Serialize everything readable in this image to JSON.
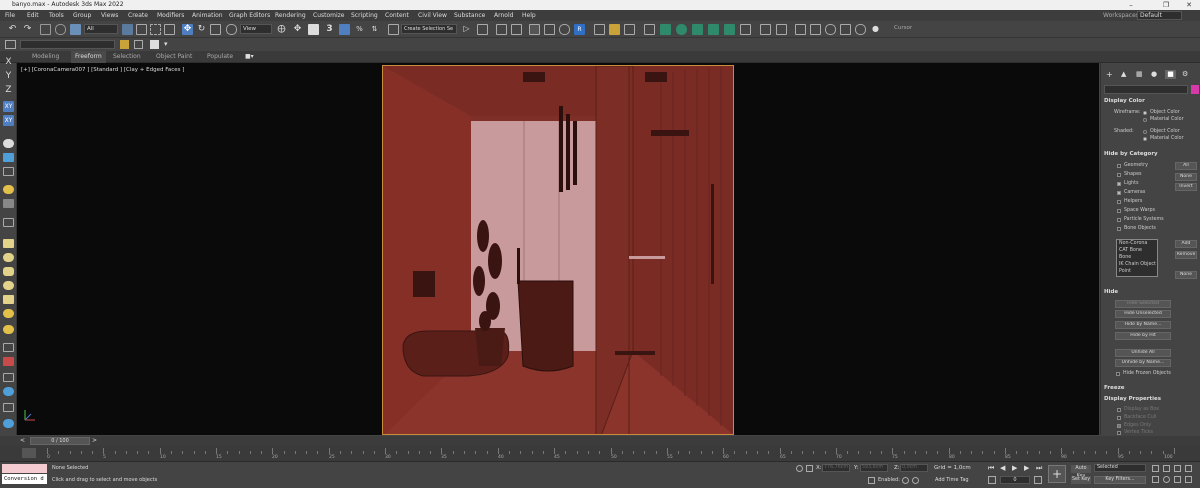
{
  "title": "banyo.max - Autodesk 3ds Max 2022",
  "menus": [
    "File",
    "Edit",
    "Tools",
    "Group",
    "Views",
    "Create",
    "Modifiers",
    "Animation",
    "Graph Editors",
    "Rendering",
    "Customize",
    "Scripting",
    "Content",
    "Civil View",
    "Substance",
    "Arnold",
    "Help"
  ],
  "workspaces_label": "Workspaces:",
  "workspace_value": "Default",
  "toolbar": {
    "filter_value": "All",
    "view_value": "View",
    "snap_value": "3",
    "selection_set": "Create Selection Se",
    "cursor_label": "Cursor"
  },
  "ribbon_tabs": [
    "Modeling",
    "Freeform",
    "Selection",
    "Object Paint",
    "Populate"
  ],
  "axes": [
    "X",
    "Y",
    "Z",
    "XY",
    "XY"
  ],
  "viewport_label": "[+] [CoronaCamera007 ] [Standard ] [Clay + Edged Faces ]",
  "command_panel": {
    "display_color": {
      "header": "Display Color",
      "wireframe_label": "Wireframe:",
      "shaded_label": "Shaded:",
      "object_color": "Object Color",
      "material_color": "Material Color"
    },
    "hide_by_category": {
      "header": "Hide by Category",
      "items": [
        "Geometry",
        "Shapes",
        "Lights",
        "Cameras",
        "Helpers",
        "Space Warps",
        "Particle Systems",
        "Bone Objects"
      ],
      "checked": [
        false,
        false,
        true,
        true,
        false,
        false,
        false,
        false
      ],
      "buttons": [
        "All",
        "None",
        "Invert"
      ],
      "list_items": [
        "Non-Corona",
        "CAT Bone",
        "Bone",
        "IK Chain Object",
        "Point"
      ],
      "list_buttons": [
        "Add",
        "Remove",
        "None"
      ]
    },
    "hide": {
      "header": "Hide",
      "buttons": [
        "Hide Selected",
        "Hide Unselected",
        "Hide by Name...",
        "Hide by Hit",
        "Unhide All",
        "Unhide by Name...",
        "Hide Frozen Objects"
      ]
    },
    "freeze_header": "Freeze",
    "display_properties": {
      "header": "Display Properties",
      "items": [
        "Display as Box",
        "Backface Cull",
        "Edges Only",
        "Vertex Ticks"
      ]
    }
  },
  "timeline": {
    "frame_label": "0 / 100",
    "ticks": [
      0,
      5,
      10,
      15,
      20,
      25,
      30,
      35,
      40,
      45,
      50,
      55,
      60,
      65,
      70,
      75,
      80,
      85,
      90,
      95,
      100
    ]
  },
  "status": {
    "maxscript": "Conversion d",
    "selection": "None Selected",
    "prompt": "Click and drag to select and move objects",
    "x_label": "X:",
    "y_label": "Y:",
    "z_label": "Z:",
    "x_value": "776,76cm",
    "y_value": "593,6cm",
    "z_value": "0,0cm",
    "grid": "Grid = 1,0cm",
    "enabled": "Enabled:",
    "add_time_tag": "Add Time Tag",
    "auto_key": "Auto Key",
    "set_key": "Set Key",
    "selected": "Selected",
    "key_filters": "Key Filters...",
    "frame_value": "0"
  }
}
